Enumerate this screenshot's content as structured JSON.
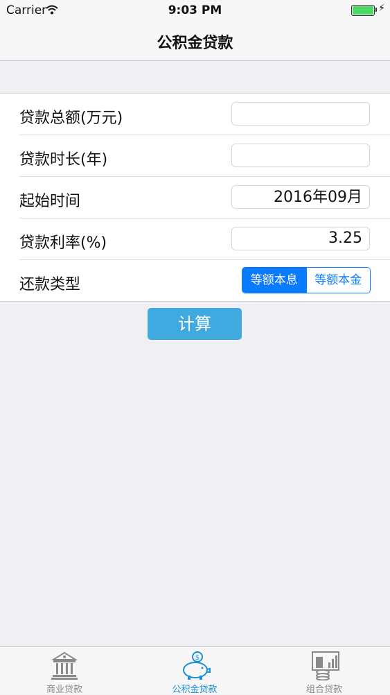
{
  "status_bar": {
    "carrier": "Carrier",
    "time": "9:03 PM"
  },
  "nav": {
    "title": "公积金贷款"
  },
  "form": {
    "rows": [
      {
        "label": "贷款总额(万元)",
        "value": ""
      },
      {
        "label": "贷款时长(年)",
        "value": ""
      },
      {
        "label": "起始时间",
        "value": "2016年09月"
      },
      {
        "label": "贷款利率(%)",
        "value": "3.25"
      },
      {
        "label": "还款类型"
      }
    ],
    "repayment_options": [
      "等额本息",
      "等额本金"
    ],
    "repayment_selected": "等额本息"
  },
  "calculate_label": "计算",
  "tabs": [
    {
      "label": "商业贷款",
      "icon": "bank-icon",
      "active": false
    },
    {
      "label": "公积金贷款",
      "icon": "piggy-bank-icon",
      "active": true
    },
    {
      "label": "组合贷款",
      "icon": "coins-chart-icon",
      "active": false
    }
  ],
  "colors": {
    "accent": "#0a7aff",
    "button": "#3fa9e0",
    "active_tab": "#1a8fd8",
    "inactive_tab": "#8a8a8a"
  }
}
